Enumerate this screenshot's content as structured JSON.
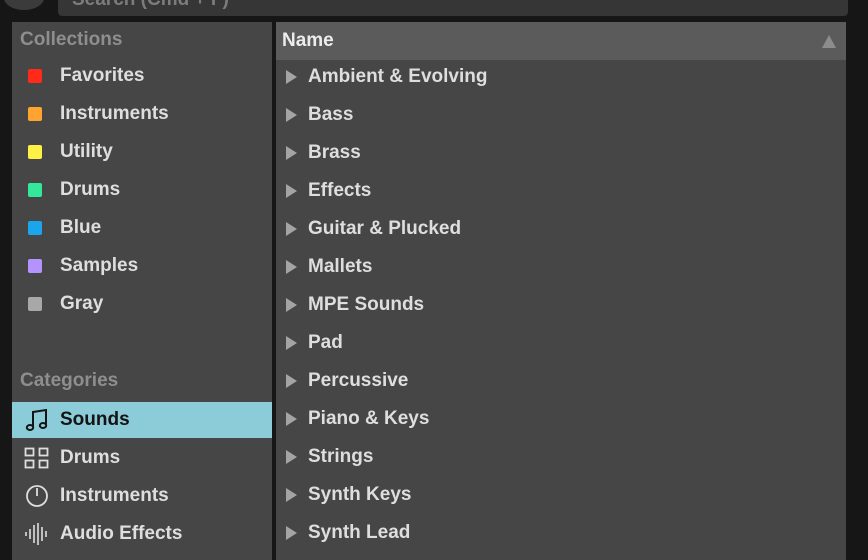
{
  "search": {
    "placeholder": "Search (Cmd + F)"
  },
  "collections": {
    "title": "Collections",
    "items": [
      {
        "label": "Favorites",
        "color": "#ff2a1a"
      },
      {
        "label": "Instruments",
        "color": "#ffa42e"
      },
      {
        "label": "Utility",
        "color": "#fff046"
      },
      {
        "label": "Drums",
        "color": "#33e89a"
      },
      {
        "label": "Blue",
        "color": "#1aa5ec"
      },
      {
        "label": "Samples",
        "color": "#b493ff"
      },
      {
        "label": "Gray",
        "color": "#a8a8a8"
      }
    ]
  },
  "categories": {
    "title": "Categories",
    "items": [
      {
        "label": "Sounds",
        "icon": "music-note-icon",
        "selected": true
      },
      {
        "label": "Drums",
        "icon": "grid-icon",
        "selected": false
      },
      {
        "label": "Instruments",
        "icon": "power-icon",
        "selected": false
      },
      {
        "label": "Audio Effects",
        "icon": "waveform-icon",
        "selected": false
      }
    ]
  },
  "list": {
    "header": "Name",
    "items": [
      "Ambient & Evolving",
      "Bass",
      "Brass",
      "Effects",
      "Guitar & Plucked",
      "Mallets",
      "MPE Sounds",
      "Pad",
      "Percussive",
      "Piano & Keys",
      "Strings",
      "Synth Keys",
      "Synth Lead"
    ]
  },
  "colors": {
    "selection": "#8ccbd8",
    "panel": "#464646",
    "header": "#5b5b5b"
  }
}
